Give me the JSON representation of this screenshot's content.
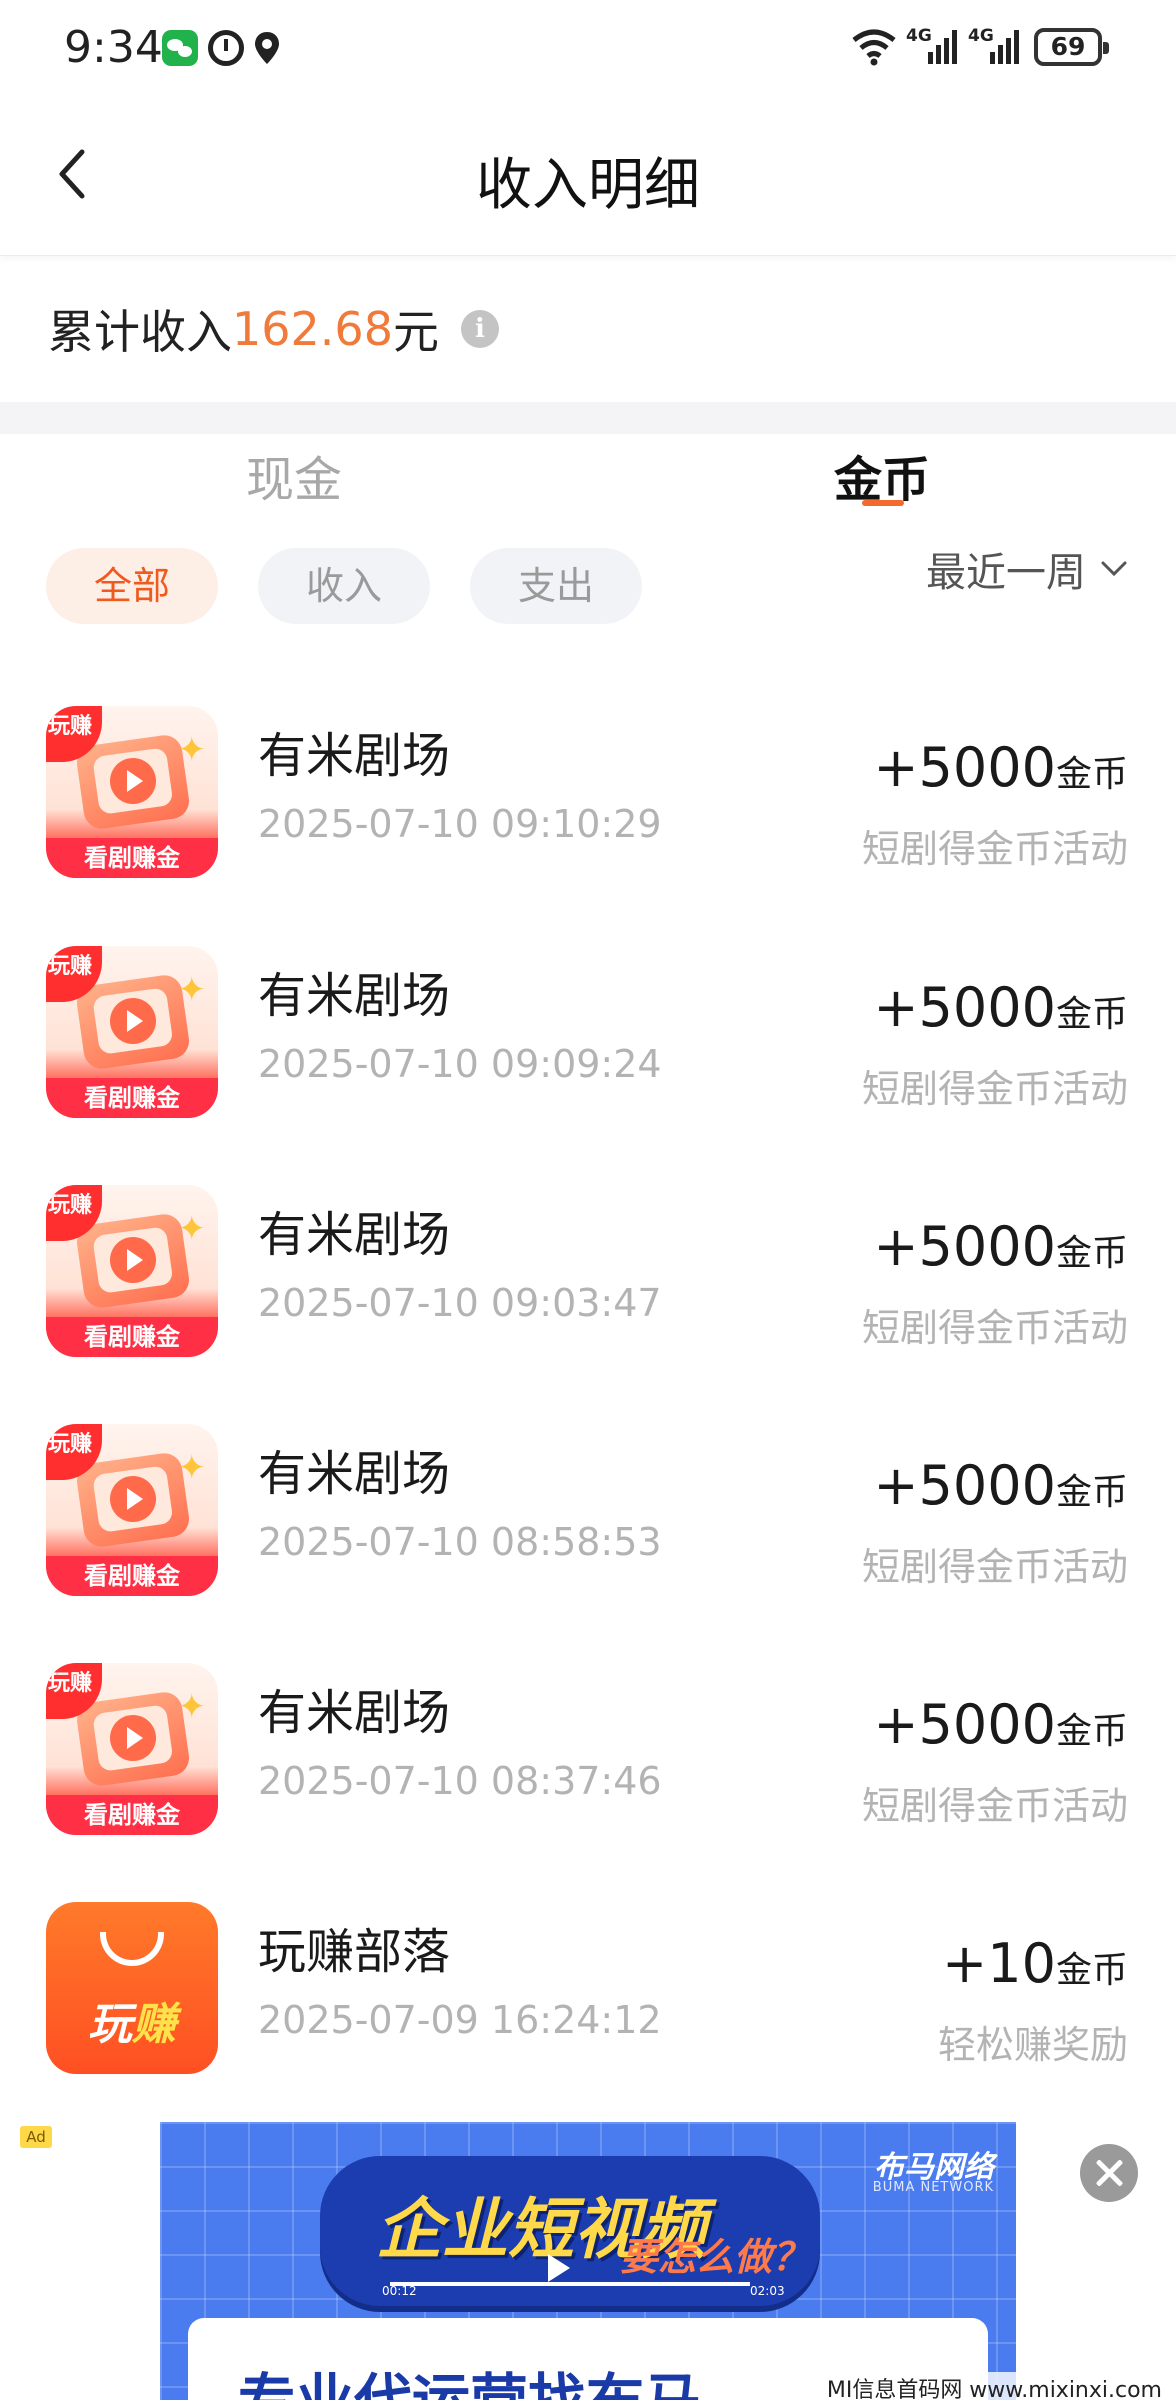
{
  "status_bar": {
    "time": "9:34",
    "network_1": "4G",
    "network_2": "4G",
    "battery": "69"
  },
  "header": {
    "title": "收入明细"
  },
  "summary": {
    "label": "累计收入",
    "amount": "162.68",
    "unit": "元",
    "info_icon": "i"
  },
  "tabs": [
    {
      "label": "现金",
      "active": false
    },
    {
      "label": "金币",
      "active": true
    }
  ],
  "filters": {
    "chips": [
      {
        "label": "全部",
        "active": true
      },
      {
        "label": "收入",
        "active": false
      },
      {
        "label": "支出",
        "active": false
      }
    ],
    "period": "最近一周"
  },
  "records": [
    {
      "name": "有米剧场",
      "time": "2025-07-10 09:10:29",
      "amount": "+5000",
      "unit": "金币",
      "desc": "短剧得金币活动",
      "icon": "drama-app-icon",
      "icon_corner": "玩赚",
      "icon_strip": "看剧赚金"
    },
    {
      "name": "有米剧场",
      "time": "2025-07-10 09:09:24",
      "amount": "+5000",
      "unit": "金币",
      "desc": "短剧得金币活动",
      "icon": "drama-app-icon",
      "icon_corner": "玩赚",
      "icon_strip": "看剧赚金"
    },
    {
      "name": "有米剧场",
      "time": "2025-07-10 09:03:47",
      "amount": "+5000",
      "unit": "金币",
      "desc": "短剧得金币活动",
      "icon": "drama-app-icon",
      "icon_corner": "玩赚",
      "icon_strip": "看剧赚金"
    },
    {
      "name": "有米剧场",
      "time": "2025-07-10 08:58:53",
      "amount": "+5000",
      "unit": "金币",
      "desc": "短剧得金币活动",
      "icon": "drama-app-icon",
      "icon_corner": "玩赚",
      "icon_strip": "看剧赚金"
    },
    {
      "name": "有米剧场",
      "time": "2025-07-10 08:37:46",
      "amount": "+5000",
      "unit": "金币",
      "desc": "短剧得金币活动",
      "icon": "drama-app-icon",
      "icon_corner": "玩赚",
      "icon_strip": "看剧赚金"
    },
    {
      "name": "玩赚部落",
      "time": "2025-07-09 16:24:12",
      "amount": "+10",
      "unit": "金币",
      "desc": "轻松赚奖励",
      "icon": "wanzhuan-app-icon",
      "icon_brand_1": "玩",
      "icon_brand_2": "赚"
    }
  ],
  "ad": {
    "badge": "Ad",
    "brand": "布马网络",
    "brand_sub": "BUMA NETWORK",
    "headline": "企业短视频",
    "sub": "要怎么做？",
    "time_start": "00:12",
    "time_end": "02:03",
    "tagline": "专业代运营找布马"
  },
  "watermark": "MI信息首码网 www.mixinxi.com",
  "colors": {
    "accent": "#f26a2e",
    "amount": "#f07a3a",
    "muted": "#b3b3b3"
  }
}
